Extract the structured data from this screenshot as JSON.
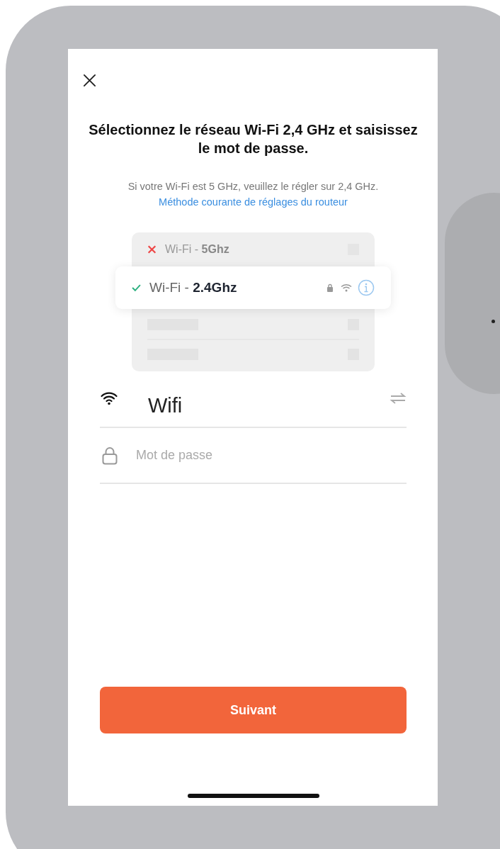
{
  "title": "Sélectionnez le réseau Wi-Fi 2,4 GHz et saisissez le mot de passe.",
  "subtitle": {
    "text": "Si votre Wi-Fi est 5 GHz, veuillez le régler sur 2,4 GHz.",
    "link": "Méthode courante de réglages du routeur"
  },
  "illustration": {
    "networks": [
      {
        "kind": "rejected",
        "label": "Wi-Fi - **5Ghz**"
      },
      {
        "kind": "accepted",
        "label": "Wi-Fi - **2.4Ghz**"
      }
    ]
  },
  "fields": [
    {
      "kind": "network",
      "value": "Wifi"
    },
    {
      "kind": "password",
      "placeholder": "Mot de passe"
    }
  ],
  "next_button": "Suivant"
}
